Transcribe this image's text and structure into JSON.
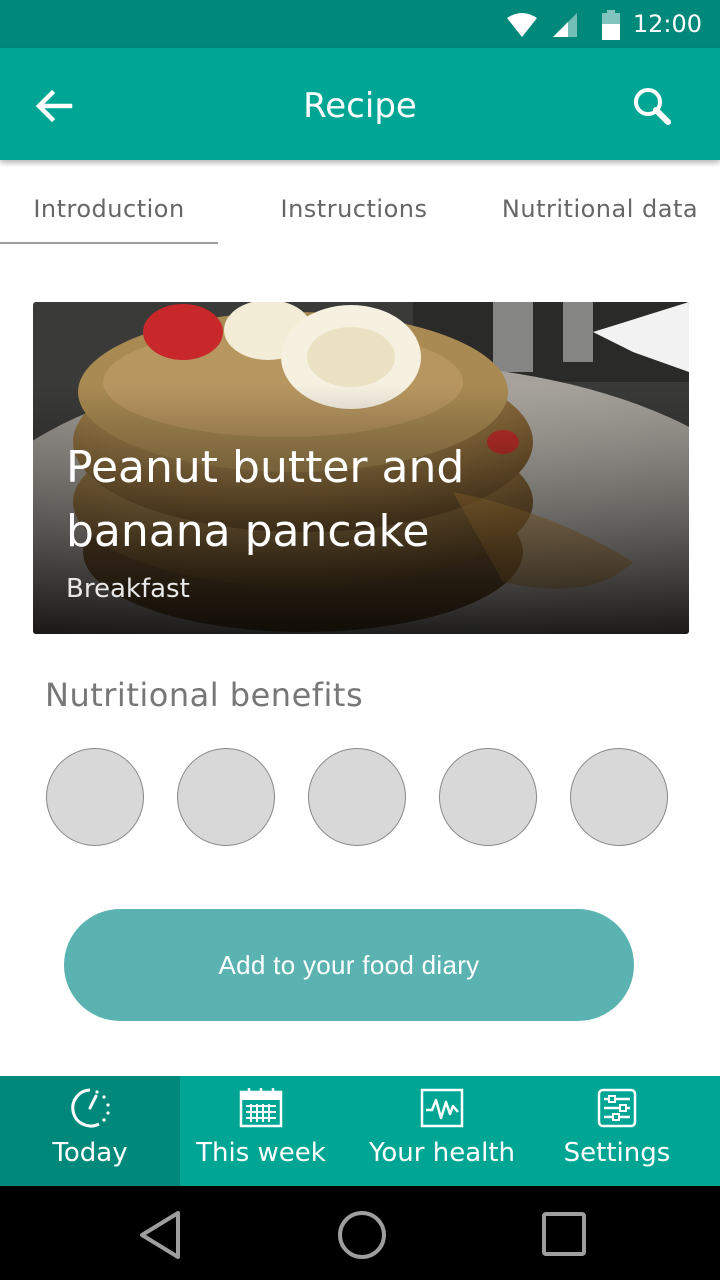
{
  "status_bar": {
    "time": "12:00",
    "icons": [
      "wifi-icon",
      "signal-icon",
      "battery-icon"
    ]
  },
  "app_bar": {
    "title": "Recipe",
    "back_icon": "arrow-back-icon",
    "search_icon": "search-icon"
  },
  "tabs": [
    {
      "label": "Introduction",
      "active": true
    },
    {
      "label": "Instructions",
      "active": false
    },
    {
      "label": "Nutritional data",
      "active": false
    }
  ],
  "recipe": {
    "title": "Peanut butter and banana pancake",
    "category": "Breakfast"
  },
  "benefits": {
    "title": "Nutritional benefits",
    "count": 5
  },
  "primary_action": {
    "label": "Add to your food diary"
  },
  "bottom_nav": [
    {
      "label": "Today",
      "icon": "clock-icon",
      "active": true
    },
    {
      "label": "This week",
      "icon": "calendar-icon",
      "active": false
    },
    {
      "label": "Your health",
      "icon": "health-chart-icon",
      "active": false
    },
    {
      "label": "Settings",
      "icon": "settings-sliders-icon",
      "active": false
    }
  ],
  "colors": {
    "primary": "#00a693",
    "primary_dark": "#00897b",
    "button": "#5bb3b1"
  }
}
